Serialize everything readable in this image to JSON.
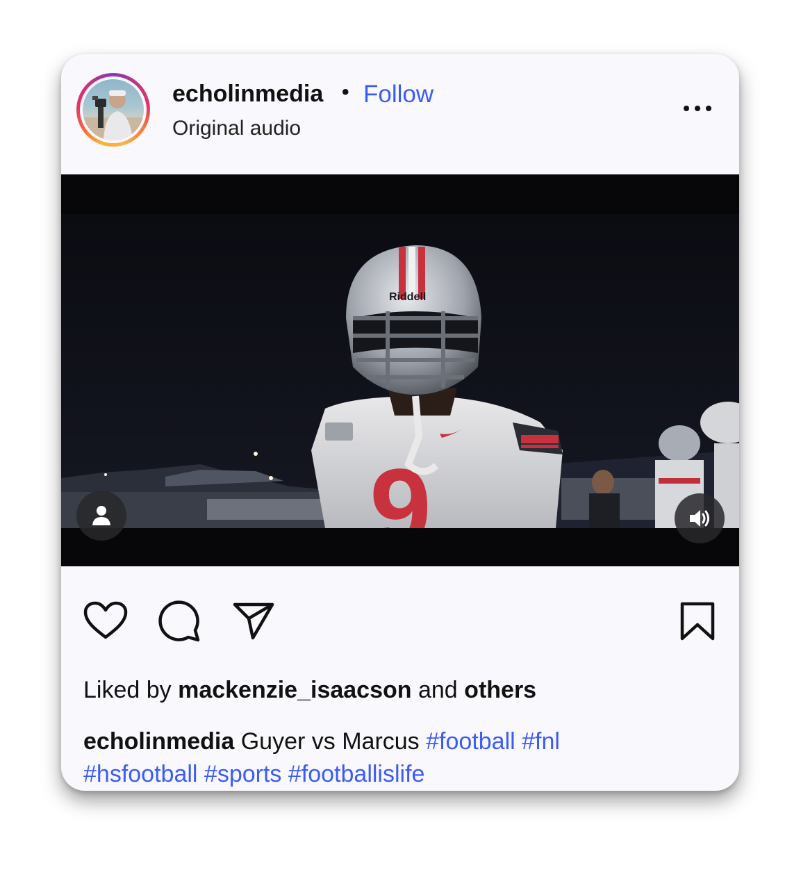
{
  "post": {
    "username": "echolinmedia",
    "separator": "•",
    "follow_label": "Follow",
    "subtitle": "Original audio"
  },
  "likes": {
    "prefix": "Liked by",
    "user": "mackenzie_isaacson",
    "joiner": "and",
    "others": "others"
  },
  "caption": {
    "user": "echolinmedia",
    "text": "Guyer vs Marcus",
    "hashtags": [
      "#football",
      "#fnl",
      "#hsfootball",
      "#sports",
      "#footballislife"
    ]
  },
  "colors": {
    "link": "#3b5bf6",
    "card_bg": "#f9f8fc",
    "text": "#111111"
  },
  "icons": [
    "more-options-icon",
    "user-tag-icon",
    "volume-icon",
    "heart-icon",
    "comment-icon",
    "share-icon",
    "bookmark-icon"
  ]
}
